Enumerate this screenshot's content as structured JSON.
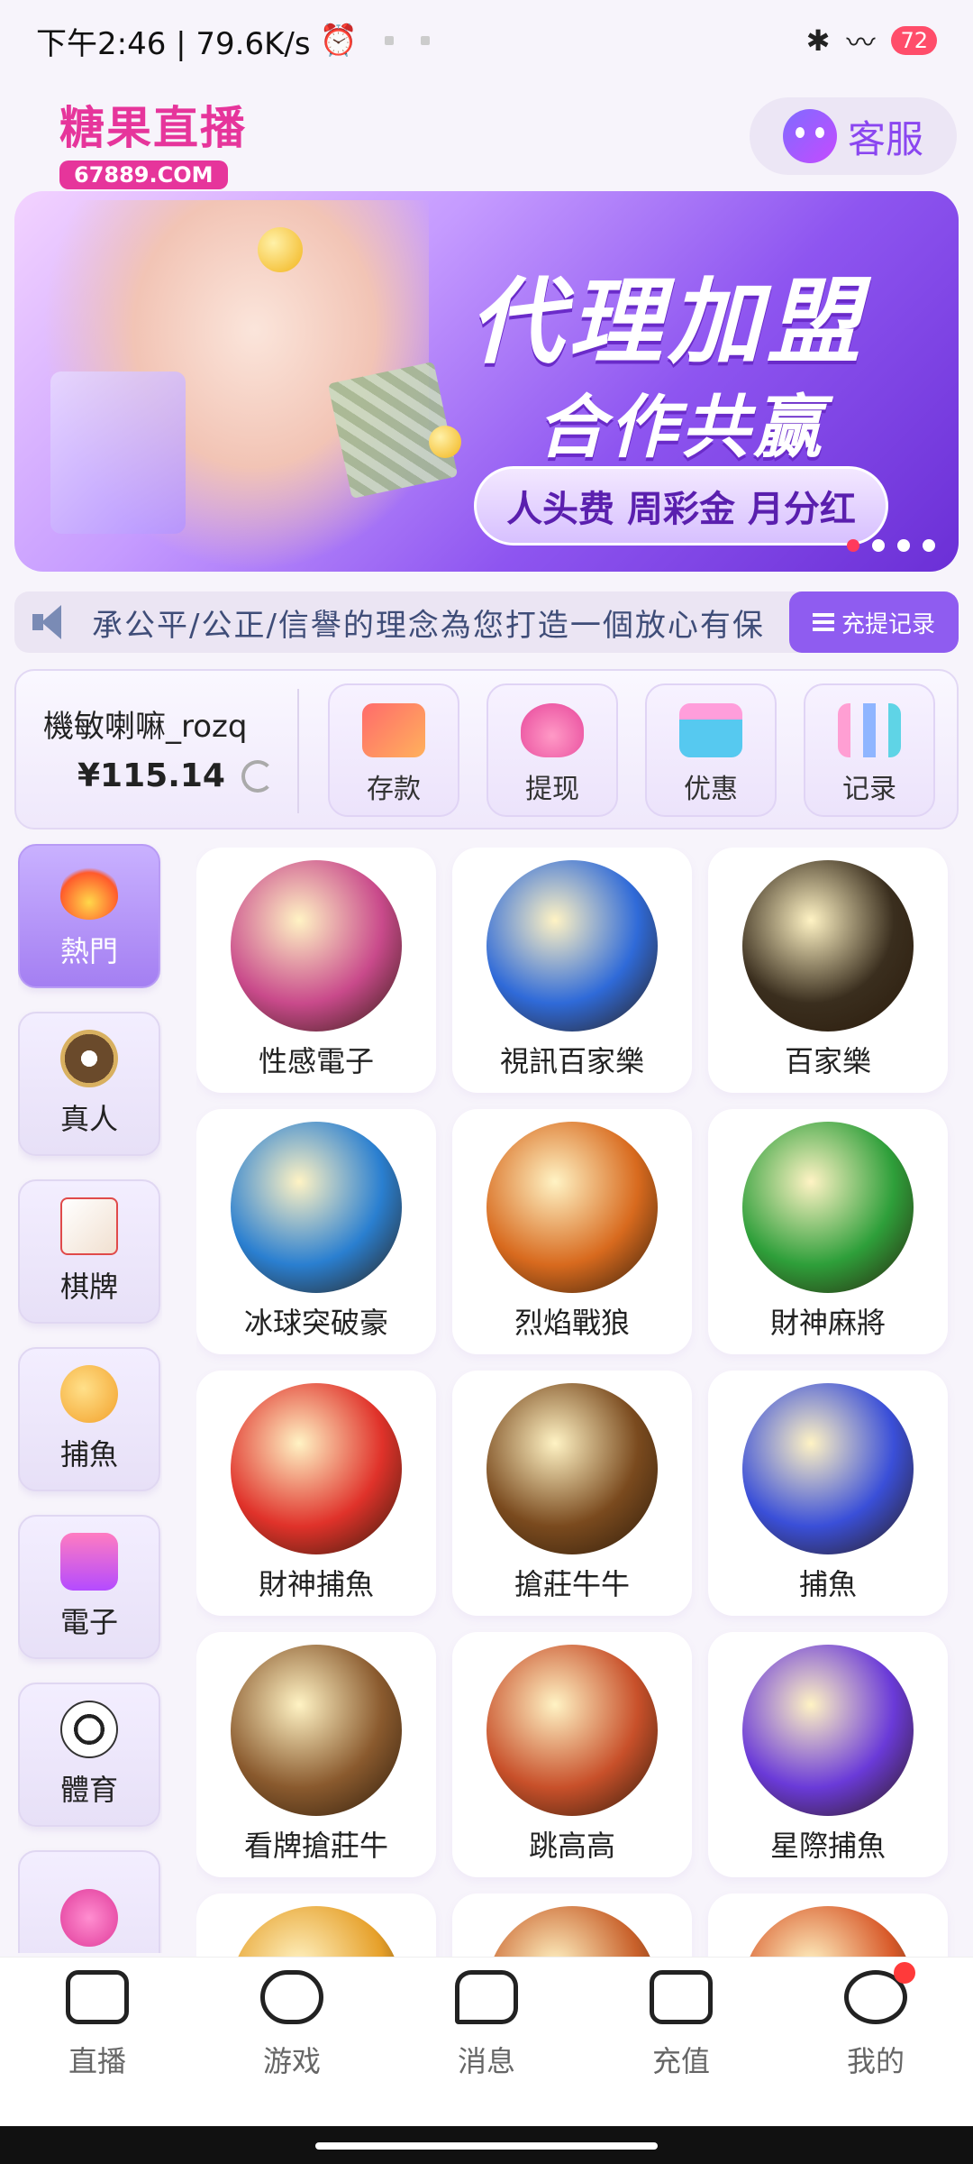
{
  "status_bar": {
    "time_speed": "下午2:46 | 79.6K/s",
    "battery": "72"
  },
  "header": {
    "logo_name": "糖果直播",
    "logo_domain": "67889.COM",
    "service_label": "客服"
  },
  "banner": {
    "title": "代理加盟",
    "subtitle": "合作共赢",
    "pill": "人头费 周彩金 月分红",
    "slides": 4,
    "active_slide": 1
  },
  "marquee": {
    "text": "承公平/公正/信譽的理念為您打造一個放心有保",
    "records_label": "充提记录"
  },
  "wallet": {
    "username": "機敏喇嘛_rozq",
    "balance": "¥115.14",
    "actions": [
      {
        "label": "存款",
        "icon": "card-icon"
      },
      {
        "label": "提现",
        "icon": "money-bag-icon"
      },
      {
        "label": "优惠",
        "icon": "gift-icon"
      },
      {
        "label": "记录",
        "icon": "bar-chart-icon"
      }
    ]
  },
  "categories": [
    {
      "label": "熱門",
      "icon": "fire-icon",
      "active": true
    },
    {
      "label": "真人",
      "icon": "poker-chip-icon",
      "active": false
    },
    {
      "label": "棋牌",
      "icon": "playing-card-icon",
      "active": false
    },
    {
      "label": "捕魚",
      "icon": "fish-icon",
      "active": false
    },
    {
      "label": "電子",
      "icon": "slot-machine-icon",
      "active": false
    },
    {
      "label": "體育",
      "icon": "soccer-ball-icon",
      "active": false
    },
    {
      "label": "",
      "icon": "lottery-ball-icon",
      "active": false
    }
  ],
  "games": [
    {
      "name": "性感電子",
      "color": "#c94a8b"
    },
    {
      "name": "視訊百家樂",
      "color": "#2f6ad8"
    },
    {
      "name": "百家樂",
      "color": "#3a2e1e"
    },
    {
      "name": "冰球突破豪",
      "color": "#2a7fd0"
    },
    {
      "name": "烈焰戰狼",
      "color": "#d86a1e"
    },
    {
      "name": "財神麻將",
      "color": "#2e9f3a"
    },
    {
      "name": "財神捕魚",
      "color": "#e0322a"
    },
    {
      "name": "搶莊牛牛",
      "color": "#7a4a1e"
    },
    {
      "name": "捕魚",
      "color": "#3a4fd8"
    },
    {
      "name": "看牌搶莊牛",
      "color": "#8a5a2e"
    },
    {
      "name": "跳高高",
      "color": "#c8502a"
    },
    {
      "name": "星際捕魚",
      "color": "#6a3ad8"
    },
    {
      "name": "",
      "color": "#e6a02a"
    },
    {
      "name": "",
      "color": "#c8602a"
    },
    {
      "name": "",
      "color": "#d85a2a"
    }
  ],
  "bottom_nav": [
    {
      "label": "直播",
      "icon": "live-icon"
    },
    {
      "label": "游戏",
      "icon": "gamepad-icon"
    },
    {
      "label": "消息",
      "icon": "message-icon"
    },
    {
      "label": "充值",
      "icon": "wallet-icon"
    },
    {
      "label": "我的",
      "icon": "profile-icon"
    }
  ]
}
